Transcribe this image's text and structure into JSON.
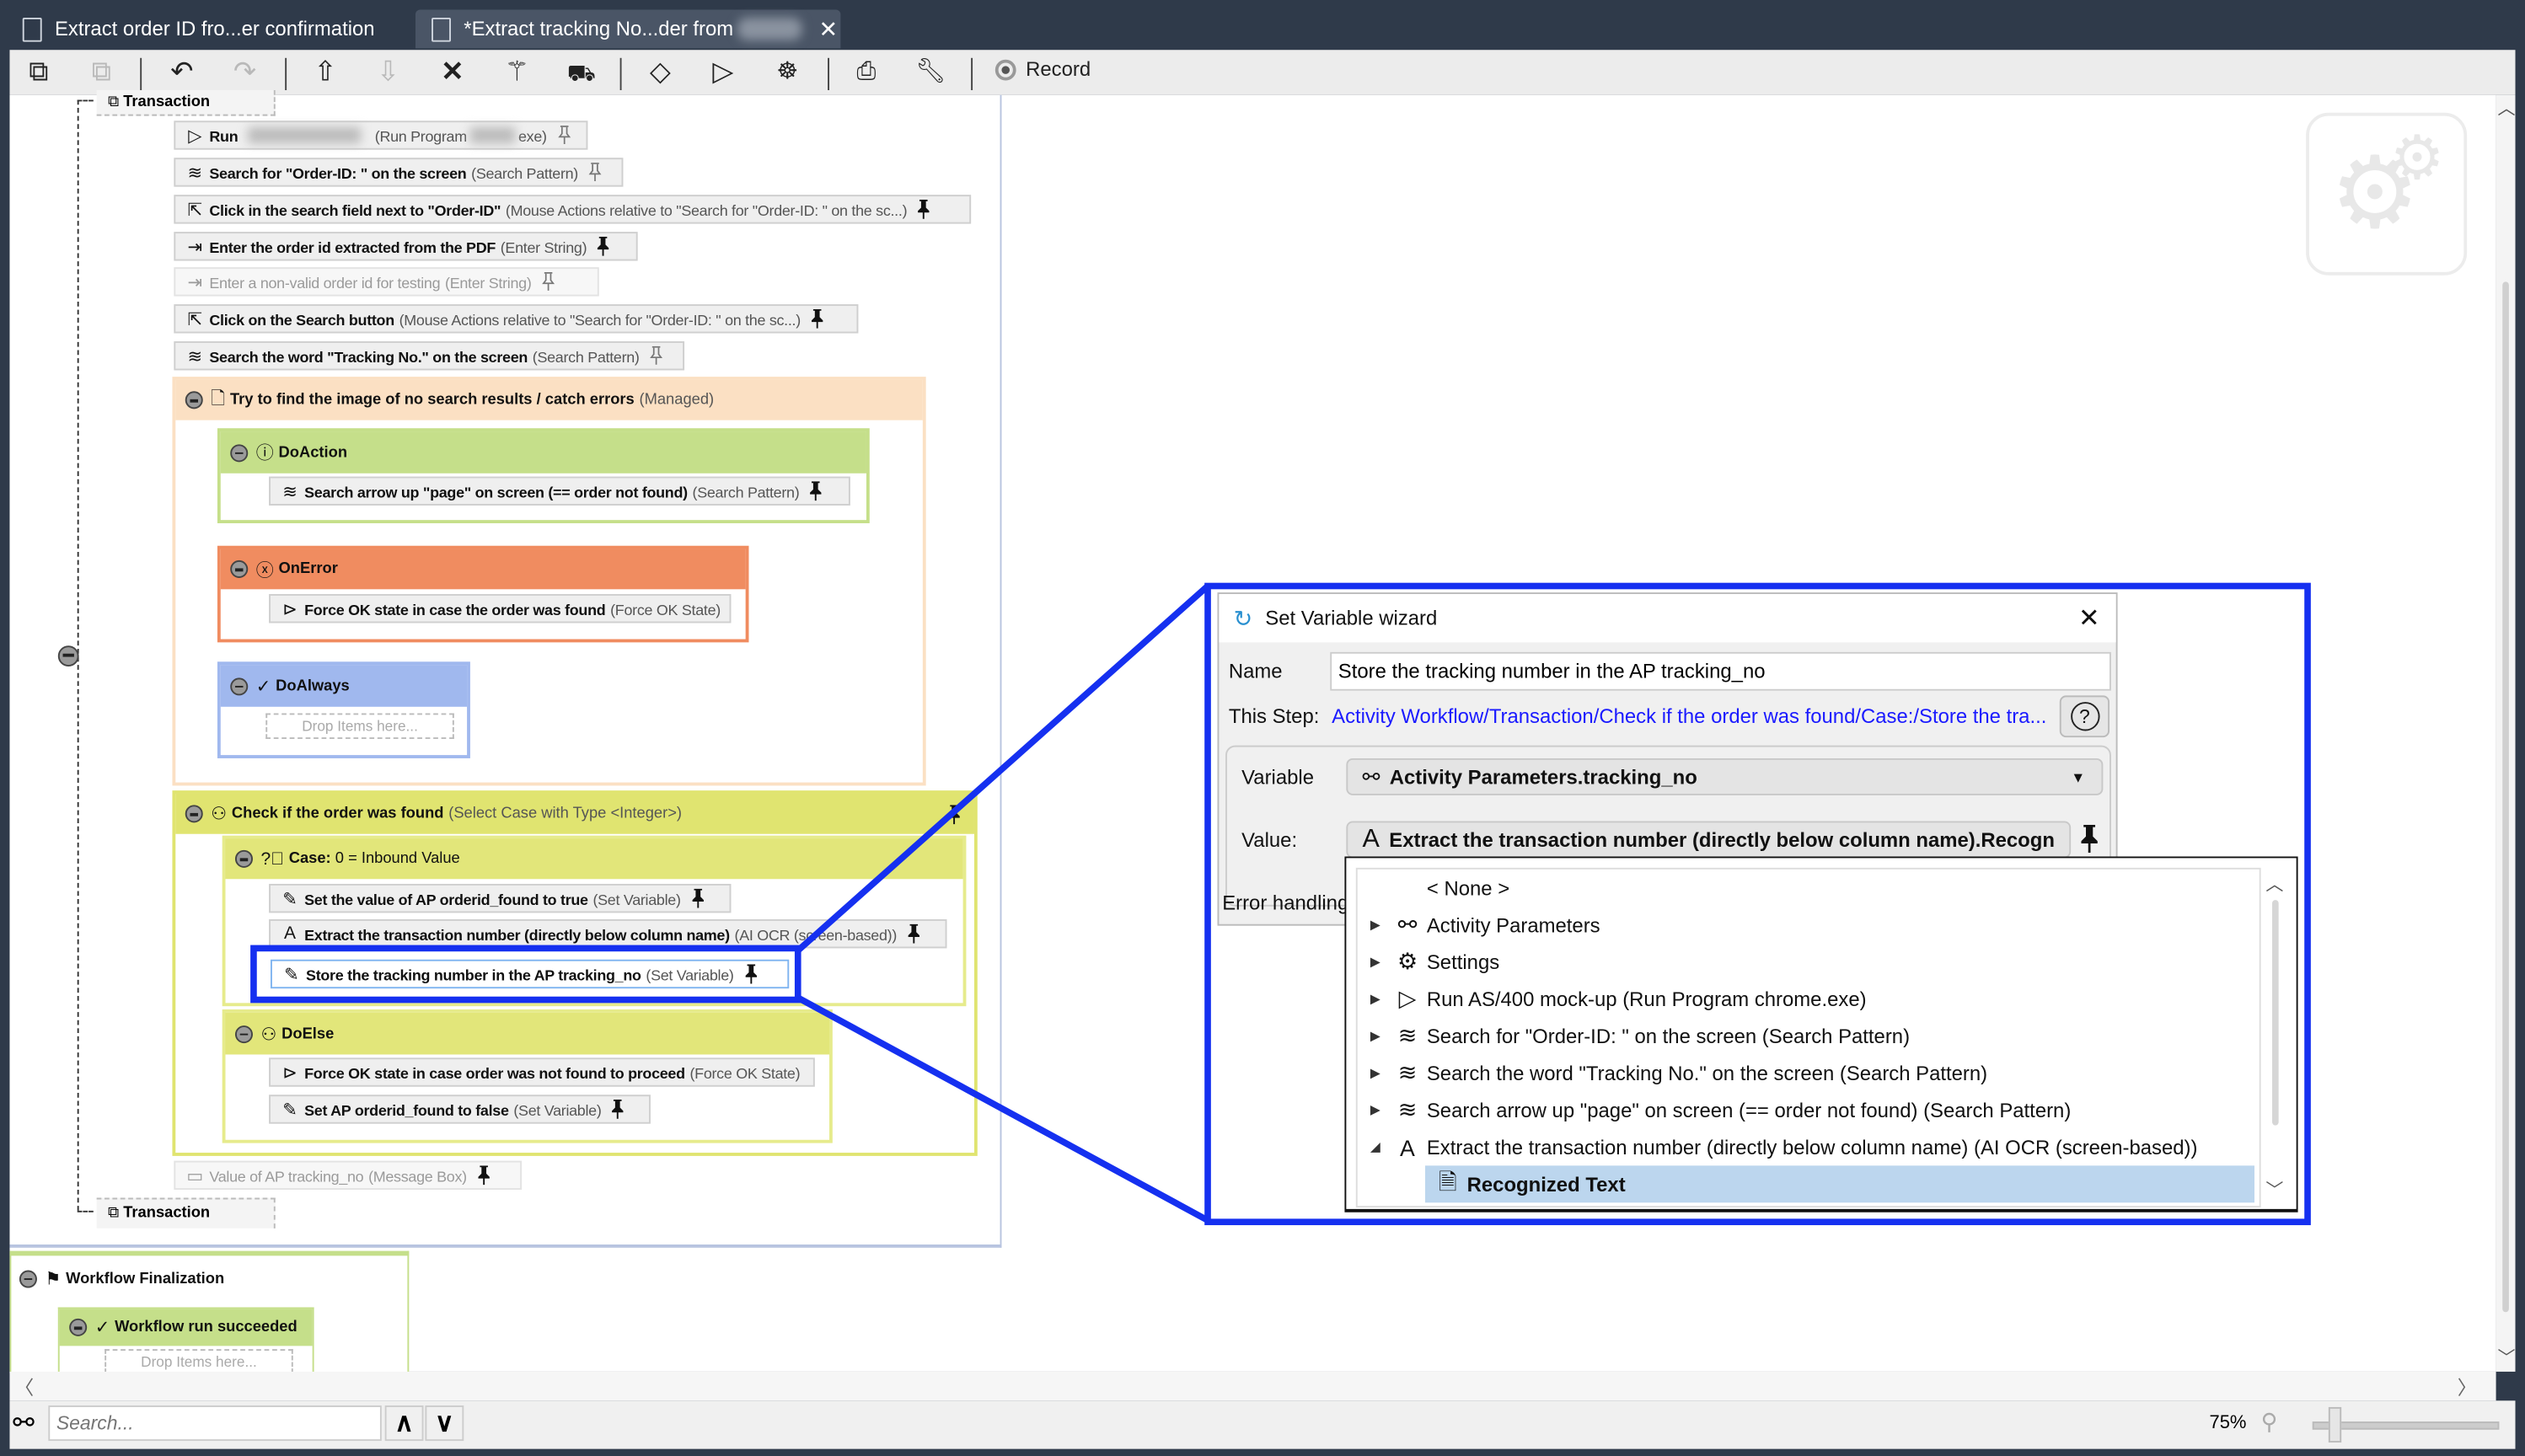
{
  "tabs": [
    {
      "label": "Extract order ID fro...er confirmation",
      "active": false
    },
    {
      "label": "*Extract tracking No...der from",
      "active": true
    }
  ],
  "toolbar": {
    "icons": [
      "copy-icon",
      "paste-icon",
      "undo-icon",
      "redo-icon",
      "move-up-icon",
      "move-down-icon",
      "delete-icon",
      "magic-wand-icon",
      "truck-icon",
      "breakpoint-icon",
      "run-icon",
      "debug-icon",
      "print-icon",
      "wrench-icon",
      "record-icon"
    ],
    "record_label": "Record"
  },
  "workflow": {
    "transaction_label": "Transaction",
    "steps": [
      {
        "title": "Run",
        "type": "(Run Program",
        "type_suffix": "exe)"
      },
      {
        "title": "Search for \"Order-ID: \" on the screen",
        "type": "(Search Pattern)"
      },
      {
        "title": "Click in the search field next to \"Order-ID\"",
        "type": "(Mouse Actions relative to \"Search for \"Order-ID: \" on the sc...)"
      },
      {
        "title": "Enter the order id extracted from the PDF",
        "type": "(Enter String)"
      },
      {
        "title": "Enter a non-valid order id for testing",
        "type": "(Enter String)"
      },
      {
        "title": "Click on the Search button",
        "type": "(Mouse Actions relative to \"Search for \"Order-ID: \" on the sc...)"
      },
      {
        "title": "Search the word \"Tracking No.\" on the screen",
        "type": "(Search Pattern)"
      }
    ],
    "managed": {
      "title": "Try to find the image of no search results / catch errors",
      "type": "(Managed)",
      "do_action": {
        "label": "DoAction",
        "step_title": "Search arrow up \"page\" on screen (== order not found)",
        "step_type": "(Search Pattern)"
      },
      "on_error": {
        "label": "OnError",
        "step_title": "Force OK state in case the order was found",
        "step_type": "(Force OK State)"
      },
      "do_always": {
        "label": "DoAlways",
        "drop": "Drop Items here..."
      }
    },
    "select_case": {
      "title": "Check if the order was found",
      "type": "(Select Case with Type <Integer>)",
      "case": {
        "label": "Case:",
        "value": "0 = Inbound Value",
        "steps": [
          {
            "title": "Set the value of AP orderid_found to true",
            "type": "(Set Variable)"
          },
          {
            "title": "Extract the transaction number (directly below column name)",
            "type": "(AI OCR (screen-based))"
          },
          {
            "title": "Store the tracking number in the AP tracking_no",
            "type": "(Set Variable)"
          }
        ]
      },
      "do_else": {
        "label": "DoElse",
        "steps": [
          {
            "title": "Force OK state in case order was not found to proceed",
            "type": "(Force OK State)"
          },
          {
            "title": "Set AP orderid_found to false",
            "type": "(Set Variable)"
          }
        ]
      }
    },
    "message_box": {
      "title": "Value of AP tracking_no",
      "type": "(Message Box)"
    },
    "finalization": {
      "label": "Workflow Finalization",
      "succeeded": "Workflow run succeeded",
      "drop": "Drop Items here..."
    }
  },
  "dialog": {
    "title": "Set Variable wizard",
    "name_label": "Name",
    "name_value": "Store the tracking number in the AP tracking_no",
    "this_step_label": "This Step:",
    "this_step_link": "Activity Workflow/Transaction/Check if the order was found/Case:/Store the tra...",
    "variable_label": "Variable",
    "variable_value": "Activity Parameters.tracking_no",
    "value_label": "Value:",
    "value_value": "Extract the transaction number (directly below column name).Recogn",
    "error_handling_label": "Error handling",
    "list": [
      {
        "label": "< None >",
        "icon": "none",
        "expander": ""
      },
      {
        "label": "Activity Parameters",
        "icon": "parameters-icon",
        "expander": "collapsed"
      },
      {
        "label": "Settings",
        "icon": "gear-icon",
        "expander": "collapsed"
      },
      {
        "label": "Run AS/400 mock-up  (Run Program chrome.exe)",
        "icon": "play-icon",
        "expander": "collapsed"
      },
      {
        "label": "Search for \"Order-ID: \" on the screen (Search Pattern)",
        "icon": "search-pattern-icon",
        "expander": "collapsed"
      },
      {
        "label": "Search the word \"Tracking No.\" on the screen (Search Pattern)",
        "icon": "search-pattern-icon",
        "expander": "collapsed"
      },
      {
        "label": "Search arrow up \"page\" on screen (== order not found) (Search Pattern)",
        "icon": "search-pattern-icon",
        "expander": "collapsed"
      },
      {
        "label": "Extract the transaction number (directly below column name) (AI OCR (screen-based))",
        "icon": "ocr-icon",
        "expander": "expanded"
      },
      {
        "label": "Recognized Text",
        "icon": "text-file-icon",
        "expander": "",
        "selected": true
      }
    ]
  },
  "statusbar": {
    "search_placeholder": "Search...",
    "zoom": "75%",
    "zoom_level_percent": 75
  },
  "colors": {
    "callout": "#1530f0",
    "managed": "#fbe0c3",
    "do_action": "#c5df8a",
    "on_error": "#f08c60",
    "do_always": "#a0b8ee",
    "select_case": "#e0e470",
    "link": "#1a1aff",
    "selection": "#bcd6ee"
  }
}
